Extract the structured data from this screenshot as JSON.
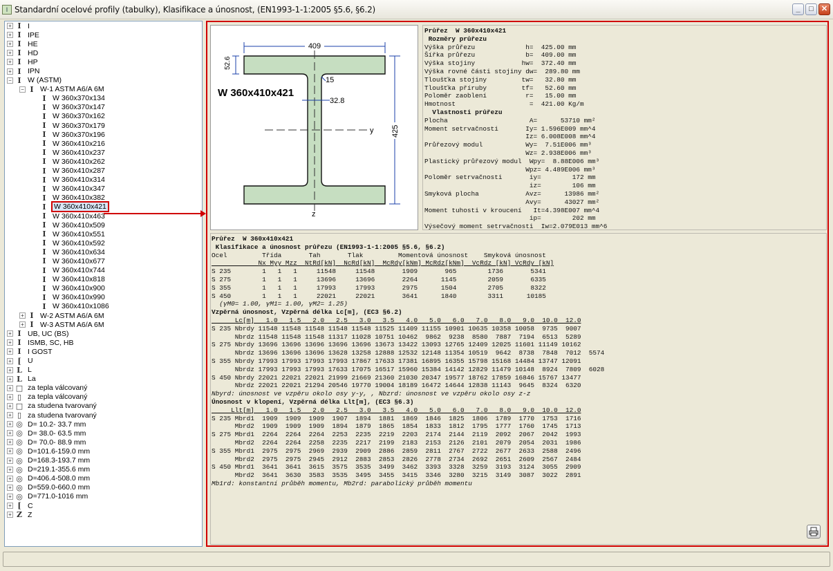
{
  "window": {
    "title": "Standardní ocelové profily (tabulky), Klasifikace a únosnost, (EN1993-1-1:2005 §5.6, §6.2)",
    "minimize": "_",
    "maximize": "□",
    "close": "✕"
  },
  "tree": [
    {
      "label": "I",
      "icon": "i-beam-icon",
      "exp": "+",
      "indent": 0
    },
    {
      "label": "IPE",
      "icon": "i-beam-icon",
      "exp": "+",
      "indent": 0
    },
    {
      "label": "HE",
      "icon": "i-beam-icon",
      "exp": "+",
      "indent": 0
    },
    {
      "label": "HD",
      "icon": "i-beam-icon",
      "exp": "+",
      "indent": 0
    },
    {
      "label": "HP",
      "icon": "i-beam-icon",
      "exp": "+",
      "indent": 0
    },
    {
      "label": "IPN",
      "icon": "i-beam-icon",
      "exp": "+",
      "indent": 0
    },
    {
      "label": "W (ASTM)",
      "icon": "i-beam-icon",
      "exp": "−",
      "indent": 0
    },
    {
      "label": "W-1 ASTM A6/A 6M",
      "icon": "i-beam-icon",
      "exp": "−",
      "indent": 1
    },
    {
      "label": "W 360x370x134",
      "icon": "i-beam-icon",
      "exp": "",
      "indent": 2
    },
    {
      "label": "W 360x370x147",
      "icon": "i-beam-icon",
      "exp": "",
      "indent": 2
    },
    {
      "label": "W 360x370x162",
      "icon": "i-beam-icon",
      "exp": "",
      "indent": 2
    },
    {
      "label": "W 360x370x179",
      "icon": "i-beam-icon",
      "exp": "",
      "indent": 2
    },
    {
      "label": "W 360x370x196",
      "icon": "i-beam-icon",
      "exp": "",
      "indent": 2
    },
    {
      "label": "W 360x410x216",
      "icon": "i-beam-icon",
      "exp": "",
      "indent": 2
    },
    {
      "label": "W 360x410x237",
      "icon": "i-beam-icon",
      "exp": "",
      "indent": 2
    },
    {
      "label": "W 360x410x262",
      "icon": "i-beam-icon",
      "exp": "",
      "indent": 2
    },
    {
      "label": "W 360x410x287",
      "icon": "i-beam-icon",
      "exp": "",
      "indent": 2
    },
    {
      "label": "W 360x410x314",
      "icon": "i-beam-icon",
      "exp": "",
      "indent": 2
    },
    {
      "label": "W 360x410x347",
      "icon": "i-beam-icon",
      "exp": "",
      "indent": 2
    },
    {
      "label": "W 360x410x382",
      "icon": "i-beam-icon",
      "exp": "",
      "indent": 2
    },
    {
      "label": "W 360x410x421",
      "icon": "i-beam-icon",
      "exp": "",
      "indent": 2,
      "selected": true
    },
    {
      "label": "W 360x410x463",
      "icon": "i-beam-icon",
      "exp": "",
      "indent": 2
    },
    {
      "label": "W 360x410x509",
      "icon": "i-beam-icon",
      "exp": "",
      "indent": 2
    },
    {
      "label": "W 360x410x551",
      "icon": "i-beam-icon",
      "exp": "",
      "indent": 2
    },
    {
      "label": "W 360x410x592",
      "icon": "i-beam-icon",
      "exp": "",
      "indent": 2
    },
    {
      "label": "W 360x410x634",
      "icon": "i-beam-icon",
      "exp": "",
      "indent": 2
    },
    {
      "label": "W 360x410x677",
      "icon": "i-beam-icon",
      "exp": "",
      "indent": 2
    },
    {
      "label": "W 360x410x744",
      "icon": "i-beam-icon",
      "exp": "",
      "indent": 2
    },
    {
      "label": "W 360x410x818",
      "icon": "i-beam-icon",
      "exp": "",
      "indent": 2
    },
    {
      "label": "W 360x410x900",
      "icon": "i-beam-icon",
      "exp": "",
      "indent": 2
    },
    {
      "label": "W 360x410x990",
      "icon": "i-beam-icon",
      "exp": "",
      "indent": 2
    },
    {
      "label": "W 360x410x1086",
      "icon": "i-beam-icon",
      "exp": "",
      "indent": 2
    },
    {
      "label": "W-2 ASTM A6/A 6M",
      "icon": "i-beam-icon",
      "exp": "+",
      "indent": 1
    },
    {
      "label": "W-3 ASTM A6/A 6M",
      "icon": "i-beam-icon",
      "exp": "+",
      "indent": 1
    },
    {
      "label": "UB, UC (BS)",
      "icon": "i-beam-icon",
      "exp": "+",
      "indent": 0
    },
    {
      "label": "ISMB, SC, HB",
      "icon": "i-beam-icon",
      "exp": "+",
      "indent": 0
    },
    {
      "label": "I GOST",
      "icon": "i-beam-icon",
      "exp": "+",
      "indent": 0
    },
    {
      "label": "U",
      "icon": "channel-icon",
      "exp": "+",
      "indent": 0
    },
    {
      "label": "L",
      "icon": "angle-icon",
      "exp": "+",
      "indent": 0
    },
    {
      "label": "La",
      "icon": "angle-icon",
      "exp": "+",
      "indent": 0
    },
    {
      "label": "za tepla válcovaný",
      "icon": "square-tube-icon",
      "exp": "+",
      "indent": 0
    },
    {
      "label": "za tepla válcovaný",
      "icon": "rect-tube-icon",
      "exp": "+",
      "indent": 0
    },
    {
      "label": "za studena tvarovaný",
      "icon": "square-tube-icon",
      "exp": "+",
      "indent": 0
    },
    {
      "label": "za studena tvarovaný",
      "icon": "rect-tube-icon",
      "exp": "+",
      "indent": 0
    },
    {
      "label": "D= 10.2- 33.7 mm",
      "icon": "pipe-icon",
      "exp": "+",
      "indent": 0
    },
    {
      "label": "D= 38.0- 63.5 mm",
      "icon": "pipe-icon",
      "exp": "+",
      "indent": 0
    },
    {
      "label": "D= 70.0- 88.9 mm",
      "icon": "pipe-icon",
      "exp": "+",
      "indent": 0
    },
    {
      "label": "D=101.6-159.0 mm",
      "icon": "pipe-icon",
      "exp": "+",
      "indent": 0
    },
    {
      "label": "D=168.3-193.7 mm",
      "icon": "pipe-icon",
      "exp": "+",
      "indent": 0
    },
    {
      "label": "D=219.1-355.6 mm",
      "icon": "pipe-icon",
      "exp": "+",
      "indent": 0
    },
    {
      "label": "D=406.4-508.0 mm",
      "icon": "pipe-icon",
      "exp": "+",
      "indent": 0
    },
    {
      "label": "D=559.0-660.0 mm",
      "icon": "pipe-icon",
      "exp": "+",
      "indent": 0
    },
    {
      "label": "D=771.0-1016 mm",
      "icon": "pipe-icon",
      "exp": "+",
      "indent": 0
    },
    {
      "label": "C",
      "icon": "c-profile-icon",
      "exp": "+",
      "indent": 0
    },
    {
      "label": "Z",
      "icon": "z-profile-icon",
      "exp": "+",
      "indent": 0
    }
  ],
  "drawing": {
    "section_name": "W 360x410x421",
    "dim_b": "409",
    "dim_tf": "52.6",
    "dim_r": "15",
    "dim_tw": "32.8",
    "dim_h": "425",
    "axis_y": "y",
    "axis_z": "z",
    "fill_color": "#c6dec1"
  },
  "props": {
    "lines": [
      {
        "t": "Průřez  W 360x410x421",
        "b": true
      },
      {
        "t": " Rozměry průřezu",
        "b": true
      },
      {
        "t": "Výška průřezu             h=  425.00 mm"
      },
      {
        "t": "Šířka průřezu             b=  409.00 mm"
      },
      {
        "t": "Výška stojiny            hw=  372.40 mm"
      },
      {
        "t": "Výška rovné části stojiny dw=  289.80 mm"
      },
      {
        "t": "Tloušťka stojiny         tw=   32.80 mm"
      },
      {
        "t": "Tloušťka příruby         tf=   52.60 mm"
      },
      {
        "t": "Poloměr zaoblení          r=   15.00 mm"
      },
      {
        "t": "Hmotnost                   =  421.00 Kg/m"
      },
      {
        "t": "  Vlastnosti průřezu",
        "b": true
      },
      {
        "t": "Plocha                     A=      53710 mm²"
      },
      {
        "t": "Moment setrvačnosti       Iy= 1.596E009 mm^4"
      },
      {
        "t": "                          Iz= 6.008E008 mm^4"
      },
      {
        "t": "Průřezový modul           Wy=  7.51E006 mm³"
      },
      {
        "t": "                          Wz= 2.938E006 mm³"
      },
      {
        "t": "Plastický průřezový modul  Wpy=  8.88E006 mm³"
      },
      {
        "t": "                          Wpz= 4.489E006 mm³"
      },
      {
        "t": "Poloměr setrvačnosti       iy=        172 mm"
      },
      {
        "t": "                           iz=        106 mm"
      },
      {
        "t": "Smyková plocha            Avz=      13986 mm²"
      },
      {
        "t": "                          Avy=      43027 mm²"
      },
      {
        "t": "Moment tuhosti v kroucení   It=4.398E007 mm^4"
      },
      {
        "t": "                           ip=        202 mm"
      },
      {
        "t": "Výsečový moment setrvačnosti  Iw=2.079E013 mm^6"
      }
    ]
  },
  "results": {
    "lines": [
      {
        "t": "Průřez  W 360x410x421",
        "b": true
      },
      {
        "t": " Klasifikace a únosnost průřezu (EN1993-1-1:2005 §5.6, §6.2)",
        "b": true
      },
      {
        "t": "Ocel         Třída       Tah       Tlak         Momentová únosnost    Smyková únosnost"
      },
      {
        "t": "            Nx Myy Mzz  NtRd[kN]  NcRd[kN]  McRdy[kNm] McRdz[kNm]  VcRdz [kN] VcRdy [kN]",
        "u": true
      },
      {
        "t": "S 235        1   1   1     11548     11548       1909       965        1736       5341"
      },
      {
        "t": "S 275        1   1   1     13696     13696       2264      1145        2059       6335"
      },
      {
        "t": "S 355        1   1   1     17993     17993       2975      1504        2705       8322"
      },
      {
        "t": "S 450        1   1   1     22021     22021       3641      1840        3311      10185"
      },
      {
        "t": "  (γM0= 1.00, γM1= 1.00, γM2= 1.25)",
        "i": true
      },
      {
        "t": "Vzpěrná únosnost, Vzpěrná délka Lc[m], (EC3 §6.2)",
        "b": true
      },
      {
        "t": "      Lc[m]   1.0   1.5   2.0   2.5   3.0   3.5   4.0   5.0   6.0   7.0   8.0   9.0  10.0  12.0",
        "u": true
      },
      {
        "t": "S 235 Nbrdy 11548 11548 11548 11548 11548 11525 11409 11155 10901 10635 10358 10058  9735  9007"
      },
      {
        "t": "      Nbrdz 11548 11548 11548 11317 11028 10751 10462  9862  9238  8580  7887  7194  6513  5289"
      },
      {
        "t": "S 275 Nbrdy 13696 13696 13696 13696 13696 13673 13422 13093 12765 12409 12025 11601 11149 10162"
      },
      {
        "t": "      Nbrdz 13696 13696 13696 13628 13258 12888 12532 12148 11354 10519  9642  8738  7848  7012  5574"
      },
      {
        "t": "S 355 Nbrdy 17993 17993 17993 17993 17867 17633 17381 16895 16355 15798 15168 14484 13747 12091"
      },
      {
        "t": "      Nbrdz 17993 17993 17993 17633 17075 16517 15960 15384 14142 12829 11479 10148  8924  7809  6028"
      },
      {
        "t": "S 450 Nbrdy 22021 22021 22021 21999 21669 21360 21030 20347 19577 18762 17859 16846 15767 13477"
      },
      {
        "t": "      Nbrdz 22021 22021 21294 20546 19770 19004 18189 16472 14644 12838 11143  9645  8324  6320"
      },
      {
        "t": "Nbyrd: únosnost ve vzpěru okolo osy y-y, , Nbzrd: únosnost ve vzpěru okolo osy z-z",
        "i": true
      },
      {
        "t": "Únosnost v klopení, Vzpěrná délka Llt[m], (EC3 §6.3)",
        "b": true
      },
      {
        "t": "     Llt[m]   1.0   1.5   2.0   2.5   3.0   3.5   4.0   5.0   6.0   7.0   8.0   9.0  10.0  12.0",
        "u": true
      },
      {
        "t": "S 235 Mbrd1  1909  1909  1909  1907  1894  1881  1869  1846  1825  1806  1789  1770  1753  1716"
      },
      {
        "t": "      Mbrd2  1909  1909  1909  1894  1879  1865  1854  1833  1812  1795  1777  1760  1745  1713"
      },
      {
        "t": "S 275 Mbrd1  2264  2264  2264  2253  2235  2219  2203  2174  2144  2119  2092  2067  2042  1993"
      },
      {
        "t": "      Mbrd2  2264  2264  2258  2235  2217  2199  2183  2153  2126  2101  2079  2054  2031  1986"
      },
      {
        "t": "S 355 Mbrd1  2975  2975  2969  2939  2909  2886  2859  2811  2767  2722  2677  2633  2588  2496"
      },
      {
        "t": "      Mbrd2  2975  2975  2945  2912  2883  2853  2826  2778  2734  2692  2651  2609  2567  2484"
      },
      {
        "t": "S 450 Mbrd1  3641  3641  3615  3575  3535  3499  3462  3393  3328  3259  3193  3124  3055  2909"
      },
      {
        "t": "      Mbrd2  3641  3630  3583  3535  3495  3455  3415  3346  3280  3215  3149  3087  3022  2891"
      },
      {
        "t": "Mb1rd: konstantní průběh momentu, Mb2rd: parabolický průběh momentu",
        "i": true
      }
    ]
  },
  "status": ""
}
